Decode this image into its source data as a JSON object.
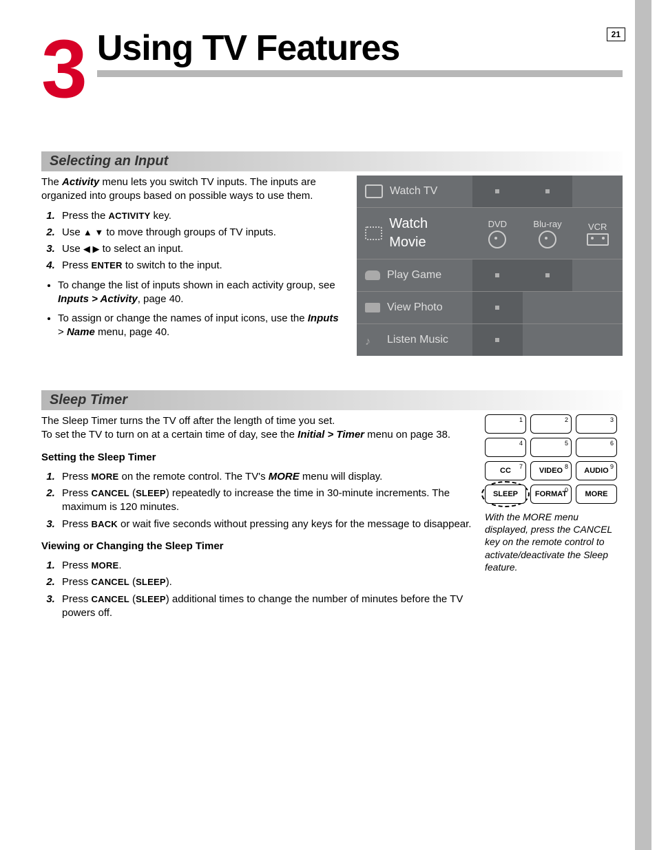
{
  "page_number": "21",
  "chapter": {
    "number": "3",
    "title": "Using TV Features"
  },
  "input": {
    "heading": "Selecting an Input",
    "intro_a": "The ",
    "intro_bold": "Activity",
    "intro_b": " menu lets you switch TV inputs.  The inputs are organized into groups based on possible ways to use them.",
    "s1a": "Press the ",
    "s1b": "ACTIVITY",
    "s1c": " key.",
    "s2a": "Use ",
    "s2arrows": "▲ ▼",
    "s2b": " to move through groups of TV inputs.",
    "s3a": "Use ",
    "s3arrows": "◀ ▶",
    "s3b": " to select an input.",
    "s4a": "Press ",
    "s4b": "ENTER",
    "s4c": " to switch to the input.",
    "b1a": "To change the list of inputs shown in each activity group, see ",
    "b1b": "Inputs > Activity",
    "b1c": ", page 40.",
    "b2a": "To assign or change the names of input icons, use the ",
    "b2b": "Inputs",
    "b2c": " > ",
    "b2d": "Name",
    "b2e": " menu, page 40.",
    "menu": {
      "r1": "Watch TV",
      "r2": "Watch Movie",
      "r2c1": "DVD",
      "r2c2": "Blu-ray",
      "r2c3": "VCR",
      "r3": "Play Game",
      "r4": "View Photo",
      "r5": "Listen Music"
    }
  },
  "sleep": {
    "heading": "Sleep Timer",
    "p1": "The Sleep Timer turns the TV off after the length of time you set.",
    "p2a": "To set the TV to turn on at a certain time of day, see the ",
    "p2b": "Initial > Timer",
    "p2c": " menu on page 38.",
    "set_head": "Setting the Sleep Timer",
    "s1a": "Press ",
    "s1b": "MORE",
    "s1c": " on the remote control. The TV's ",
    "s1d": "MORE",
    "s1e": " menu will display.",
    "s2a": "Press ",
    "s2b": "CANCEL",
    "s2c": " (",
    "s2d": "SLEEP",
    "s2e": ") repeatedly to increase the time in 30-minute increments. The maximum is 120 minutes.",
    "s3a": "Press ",
    "s3b": "BACK",
    "s3c": " or wait five seconds without pressing any keys for the message to disappear.",
    "view_head": "Viewing or Changing the Sleep Timer",
    "v1a": "Press ",
    "v1b": "MORE",
    "v1c": ".",
    "v2a": "Press ",
    "v2b": "CANCEL",
    "v2c": " (",
    "v2d": "SLEEP",
    "v2e": ").",
    "v3a": "Press ",
    "v3b": "CANCEL",
    "v3c": " (",
    "v3d": "SLEEP",
    "v3e": ") additional times to change the number of minutes before the TV powers off.",
    "remote": {
      "n1": "1",
      "n2": "2",
      "n3": "3",
      "n4": "4",
      "n5": "5",
      "n6": "6",
      "n7": "7",
      "n8": "8",
      "n9": "9",
      "n0": "0",
      "cc": "CC",
      "video": "VIDEO",
      "audio": "AUDIO",
      "sleep": "SLEEP",
      "format": "FORMAT",
      "more": "MORE"
    },
    "caption": "With the MORE menu displayed, press the CANCEL key on the remote control to activate/deactivate the Sleep feature."
  }
}
